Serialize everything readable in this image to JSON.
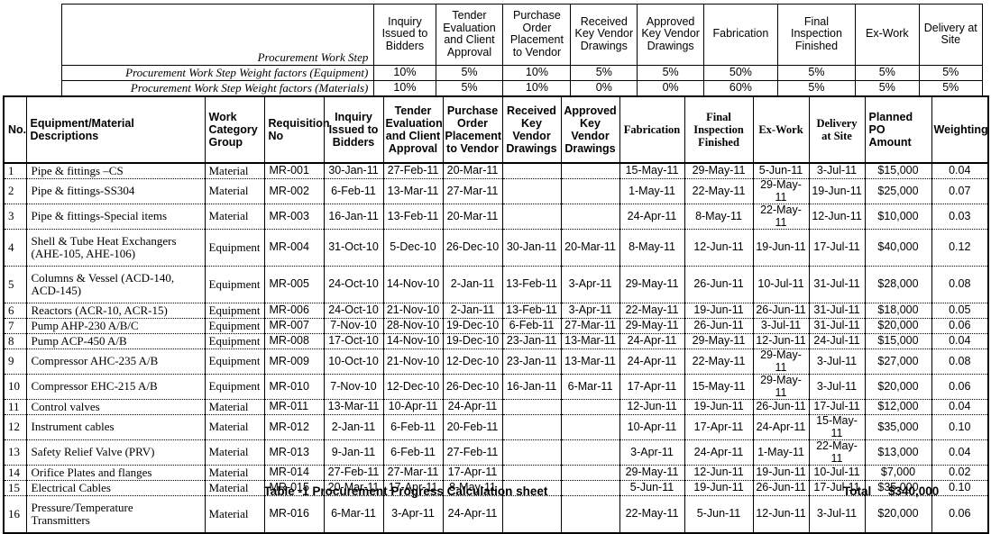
{
  "weight_factor_table": {
    "step_label": "Procurement Work Step",
    "columns": [
      "Inquiry Issued to Bidders",
      "Tender Evaluation and Client Approval",
      "Purchase Order Placement to Vendor",
      "Received Key Vendor Drawings",
      "Approved Key Vendor Drawings",
      "Fabrication",
      "Final Inspection Finished",
      "Ex-Work",
      "Delivery at Site"
    ],
    "rows": [
      {
        "label": "Procurement Work Step Weight factors (Equipment)",
        "values": [
          "10%",
          "5%",
          "10%",
          "5%",
          "5%",
          "50%",
          "5%",
          "5%",
          "5%"
        ]
      },
      {
        "label": "Procurement Work Step Weight factors (Materials)",
        "values": [
          "10%",
          "5%",
          "10%",
          "0%",
          "0%",
          "60%",
          "5%",
          "5%",
          "5%"
        ]
      }
    ]
  },
  "main_table": {
    "headers": [
      "No.",
      "Equipment/Material Descriptions",
      "Work Category Group",
      "Requisition No",
      "Inquiry Issued to Bidders",
      "Tender Evaluation and Client Approval",
      "Purchase Order Placement to Vendor",
      "Received Key Vendor Drawings",
      "Approved Key Vendor Drawings",
      "Fabrication",
      "Final Inspection Finished",
      "Ex-Work",
      "Delivery at Site",
      "Planned PO Amount",
      "Weighting"
    ],
    "rows": [
      {
        "no": "1",
        "description": [
          "Pipe & fittings –CS"
        ],
        "work_category_group": "Material",
        "requisition_no": "MR-001",
        "inquiry_issued": "30-Jan-11",
        "tender_evaluation": "27-Feb-11",
        "po_placement": "20-Mar-11",
        "received_key_drawings": "",
        "approved_key_drawings": "",
        "fabrication": "15-May-11",
        "final_inspection": "29-May-11",
        "ex_work": "5-Jun-11",
        "delivery_at_site": "3-Jul-11",
        "planned_po_amount": "$15,000",
        "weighting": "0.04"
      },
      {
        "no": "2",
        "description": [
          "Pipe & fittings-SS304"
        ],
        "work_category_group": "Material",
        "requisition_no": "MR-002",
        "inquiry_issued": "6-Feb-11",
        "tender_evaluation": "13-Mar-11",
        "po_placement": "27-Mar-11",
        "received_key_drawings": "",
        "approved_key_drawings": "",
        "fabrication": "1-May-11",
        "final_inspection": "22-May-11",
        "ex_work": "29-May-11",
        "delivery_at_site": "19-Jun-11",
        "planned_po_amount": "$25,000",
        "weighting": "0.07"
      },
      {
        "no": "3",
        "description": [
          "Pipe & fittings-Special items"
        ],
        "work_category_group": "Material",
        "requisition_no": "MR-003",
        "inquiry_issued": "16-Jan-11",
        "tender_evaluation": "13-Feb-11",
        "po_placement": "20-Mar-11",
        "received_key_drawings": "",
        "approved_key_drawings": "",
        "fabrication": "24-Apr-11",
        "final_inspection": "8-May-11",
        "ex_work": "22-May-11",
        "delivery_at_site": "12-Jun-11",
        "planned_po_amount": "$10,000",
        "weighting": "0.03"
      },
      {
        "no": "4",
        "description": [
          "Shell & Tube Heat Exchangers",
          "(AHE-105, AHE-106)"
        ],
        "work_category_group": "Equipment",
        "requisition_no": "MR-004",
        "inquiry_issued": "31-Oct-10",
        "tender_evaluation": "5-Dec-10",
        "po_placement": "26-Dec-10",
        "received_key_drawings": "30-Jan-11",
        "approved_key_drawings": "20-Mar-11",
        "fabrication": "8-May-11",
        "final_inspection": "12-Jun-11",
        "ex_work": "19-Jun-11",
        "delivery_at_site": "17-Jul-11",
        "planned_po_amount": "$40,000",
        "weighting": "0.12"
      },
      {
        "no": "5",
        "description": [
          "Columns & Vessel (ACD-140,",
          "ACD-145)"
        ],
        "work_category_group": "Equipment",
        "requisition_no": "MR-005",
        "inquiry_issued": "24-Oct-10",
        "tender_evaluation": "14-Nov-10",
        "po_placement": "2-Jan-11",
        "received_key_drawings": "13-Feb-11",
        "approved_key_drawings": "3-Apr-11",
        "fabrication": "29-May-11",
        "final_inspection": "26-Jun-11",
        "ex_work": "10-Jul-11",
        "delivery_at_site": "31-Jul-11",
        "planned_po_amount": "$28,000",
        "weighting": "0.08"
      },
      {
        "no": "6",
        "description": [
          "Reactors (ACR-10, ACR-15)"
        ],
        "work_category_group": "Equipment",
        "requisition_no": "MR-006",
        "inquiry_issued": "24-Oct-10",
        "tender_evaluation": "21-Nov-10",
        "po_placement": "2-Jan-11",
        "received_key_drawings": "13-Feb-11",
        "approved_key_drawings": "3-Apr-11",
        "fabrication": "22-May-11",
        "final_inspection": "19-Jun-11",
        "ex_work": "26-Jun-11",
        "delivery_at_site": "31-Jul-11",
        "planned_po_amount": "$18,000",
        "weighting": "0.05"
      },
      {
        "no": "7",
        "description": [
          "Pump AHP-230 A/B/C"
        ],
        "work_category_group": "Equipment",
        "requisition_no": "MR-007",
        "inquiry_issued": "7-Nov-10",
        "tender_evaluation": "28-Nov-10",
        "po_placement": "19-Dec-10",
        "received_key_drawings": "6-Feb-11",
        "approved_key_drawings": "27-Mar-11",
        "fabrication": "29-May-11",
        "final_inspection": "26-Jun-11",
        "ex_work": "3-Jul-11",
        "delivery_at_site": "31-Jul-11",
        "planned_po_amount": "$20,000",
        "weighting": "0.06"
      },
      {
        "no": "8",
        "description": [
          "Pump ACP-450 A/B"
        ],
        "work_category_group": "Equipment",
        "requisition_no": "MR-008",
        "inquiry_issued": "17-Oct-10",
        "tender_evaluation": "14-Nov-10",
        "po_placement": "19-Dec-10",
        "received_key_drawings": "23-Jan-11",
        "approved_key_drawings": "13-Mar-11",
        "fabrication": "24-Apr-11",
        "final_inspection": "29-May-11",
        "ex_work": "12-Jun-11",
        "delivery_at_site": "24-Jul-11",
        "planned_po_amount": "$15,000",
        "weighting": "0.04"
      },
      {
        "no": "9",
        "description": [
          "Compressor AHC-235 A/B"
        ],
        "work_category_group": "Equipment",
        "requisition_no": "MR-009",
        "inquiry_issued": "10-Oct-10",
        "tender_evaluation": "21-Nov-10",
        "po_placement": "12-Dec-10",
        "received_key_drawings": "23-Jan-11",
        "approved_key_drawings": "13-Mar-11",
        "fabrication": "24-Apr-11",
        "final_inspection": "22-May-11",
        "ex_work": "29-May-11",
        "delivery_at_site": "3-Jul-11",
        "planned_po_amount": "$27,000",
        "weighting": "0.08"
      },
      {
        "no": "10",
        "description": [
          "Compressor EHC-215 A/B"
        ],
        "work_category_group": "Equipment",
        "requisition_no": "MR-010",
        "inquiry_issued": "7-Nov-10",
        "tender_evaluation": "12-Dec-10",
        "po_placement": "26-Dec-10",
        "received_key_drawings": "16-Jan-11",
        "approved_key_drawings": "6-Mar-11",
        "fabrication": "17-Apr-11",
        "final_inspection": "15-May-11",
        "ex_work": "29-May-11",
        "delivery_at_site": "3-Jul-11",
        "planned_po_amount": "$20,000",
        "weighting": "0.06"
      },
      {
        "no": "11",
        "description": [
          "Control valves"
        ],
        "work_category_group": "Material",
        "requisition_no": "MR-011",
        "inquiry_issued": "13-Mar-11",
        "tender_evaluation": "10-Apr-11",
        "po_placement": "24-Apr-11",
        "received_key_drawings": "",
        "approved_key_drawings": "",
        "fabrication": "12-Jun-11",
        "final_inspection": "19-Jun-11",
        "ex_work": "26-Jun-11",
        "delivery_at_site": "17-Jul-11",
        "planned_po_amount": "$12,000",
        "weighting": "0.04"
      },
      {
        "no": "12",
        "description": [
          "Instrument cables"
        ],
        "work_category_group": "Material",
        "requisition_no": "MR-012",
        "inquiry_issued": "2-Jan-11",
        "tender_evaluation": "6-Feb-11",
        "po_placement": "20-Feb-11",
        "received_key_drawings": "",
        "approved_key_drawings": "",
        "fabrication": "10-Apr-11",
        "final_inspection": "17-Apr-11",
        "ex_work": "24-Apr-11",
        "delivery_at_site": "15-May-11",
        "planned_po_amount": "$35,000",
        "weighting": "0.10"
      },
      {
        "no": "13",
        "description": [
          "Safety Relief Valve (PRV)"
        ],
        "work_category_group": "Material",
        "requisition_no": "MR-013",
        "inquiry_issued": "9-Jan-11",
        "tender_evaluation": "6-Feb-11",
        "po_placement": "27-Feb-11",
        "received_key_drawings": "",
        "approved_key_drawings": "",
        "fabrication": "3-Apr-11",
        "final_inspection": "24-Apr-11",
        "ex_work": "1-May-11",
        "delivery_at_site": "22-May-11",
        "planned_po_amount": "$13,000",
        "weighting": "0.04"
      },
      {
        "no": "14",
        "description": [
          "Orifice Plates and flanges"
        ],
        "work_category_group": "Material",
        "requisition_no": "MR-014",
        "inquiry_issued": "27-Feb-11",
        "tender_evaluation": "27-Mar-11",
        "po_placement": "17-Apr-11",
        "received_key_drawings": "",
        "approved_key_drawings": "",
        "fabrication": "29-May-11",
        "final_inspection": "12-Jun-11",
        "ex_work": "19-Jun-11",
        "delivery_at_site": "10-Jul-11",
        "planned_po_amount": "$7,000",
        "weighting": "0.02"
      },
      {
        "no": "15",
        "description": [
          "Electrical Cables"
        ],
        "work_category_group": "Material",
        "requisition_no": "MR-015",
        "inquiry_issued": "20-Mar-11",
        "tender_evaluation": "17-Apr-11",
        "po_placement": "8-May-11",
        "received_key_drawings": "",
        "approved_key_drawings": "",
        "fabrication": "5-Jun-11",
        "final_inspection": "19-Jun-11",
        "ex_work": "26-Jun-11",
        "delivery_at_site": "17-Jul-11",
        "planned_po_amount": "$35,000",
        "weighting": "0.10"
      },
      {
        "no": "16",
        "description": [
          "Pressure/Temperature",
          "Transmitters"
        ],
        "work_category_group": "Material",
        "requisition_no": "MR-016",
        "inquiry_issued": "6-Mar-11",
        "tender_evaluation": "3-Apr-11",
        "po_placement": "24-Apr-11",
        "received_key_drawings": "",
        "approved_key_drawings": "",
        "fabrication": "22-May-11",
        "final_inspection": "5-Jun-11",
        "ex_work": "12-Jun-11",
        "delivery_at_site": "3-Jul-11",
        "planned_po_amount": "$20,000",
        "weighting": "0.06"
      }
    ]
  },
  "footer": {
    "caption": "Table -1 Procurement Progress Calculation sheet",
    "total_label": "Total",
    "total_value": "$340,000"
  }
}
